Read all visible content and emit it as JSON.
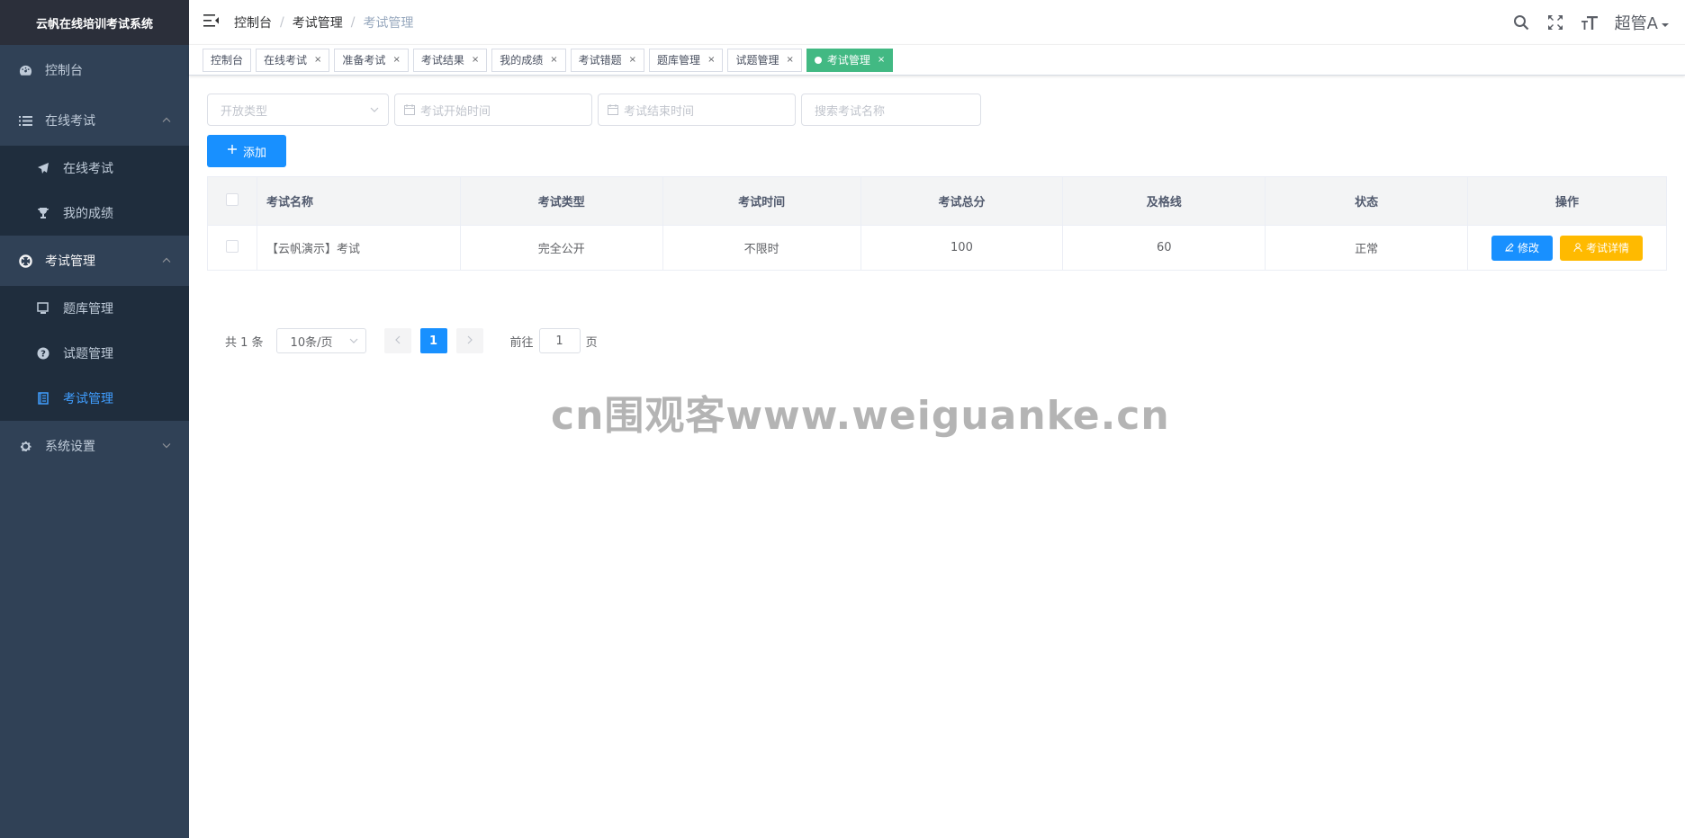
{
  "app": {
    "title": "云帆在线培训考试系统"
  },
  "sidebar": {
    "dashboard": "控制台",
    "online_exam": {
      "label": "在线考试",
      "items": [
        {
          "label": "在线考试"
        },
        {
          "label": "我的成绩"
        }
      ]
    },
    "exam_manage": {
      "label": "考试管理",
      "items": [
        {
          "label": "题库管理"
        },
        {
          "label": "试题管理"
        },
        {
          "label": "考试管理"
        }
      ]
    },
    "system": {
      "label": "系统设置"
    }
  },
  "breadcrumb": [
    "控制台",
    "考试管理",
    "考试管理"
  ],
  "breadcrumb_sep": "/",
  "user": {
    "name": "超管A"
  },
  "tags": [
    {
      "label": "控制台"
    },
    {
      "label": "在线考试"
    },
    {
      "label": "准备考试"
    },
    {
      "label": "考试结果"
    },
    {
      "label": "我的成绩"
    },
    {
      "label": "考试错题"
    },
    {
      "label": "题库管理"
    },
    {
      "label": "试题管理"
    },
    {
      "label": "考试管理"
    }
  ],
  "tag_close": "×",
  "filters": {
    "open_type_placeholder": "开放类型",
    "start_time_placeholder": "考试开始时间",
    "end_time_placeholder": "考试结束时间",
    "search_placeholder": "搜索考试名称"
  },
  "add_button": "添加",
  "table": {
    "columns": [
      "考试名称",
      "考试类型",
      "考试时间",
      "考试总分",
      "及格线",
      "状态",
      "操作"
    ],
    "rows": [
      {
        "name": "【云帆演示】考试",
        "type": "完全公开",
        "time": "不限时",
        "total": "100",
        "pass": "60",
        "status": "正常"
      }
    ],
    "edit_label": "修改",
    "detail_label": "考试详情"
  },
  "pagination": {
    "total": "共 1 条",
    "page_size": "10条/页",
    "current": "1",
    "goto_prefix": "前往",
    "goto_value": "1",
    "goto_suffix": "页"
  },
  "watermark": "cn围观客www.weiguanke.cn",
  "colors": {
    "sidebar": "#304156",
    "primary": "#1890ff",
    "active_tag": "#42b983",
    "warning": "#ffba00"
  }
}
